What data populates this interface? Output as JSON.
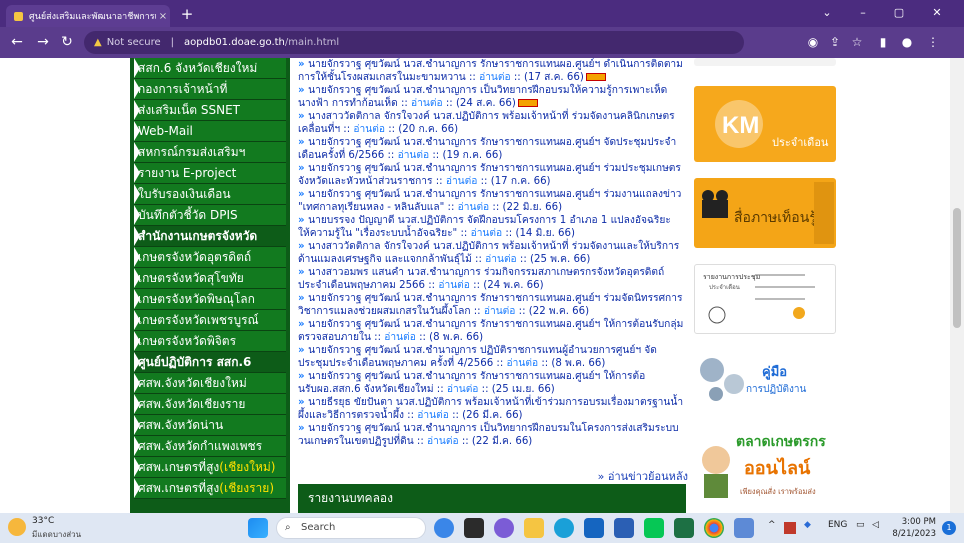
{
  "browser": {
    "tab_title": "ศูนย์ส่งเสริมและพัฒนาอาชีพการเกษตร",
    "tab_close": "×",
    "new_tab": "+",
    "not_secure": "Not secure",
    "separator": "|",
    "url_domain": "aopdb01.doae.go.th",
    "url_path": "/main.html",
    "win_controls": [
      "⌄",
      "–",
      "▢",
      "✕"
    ]
  },
  "sidebar": {
    "items": [
      {
        "label": "สสก.6 จังหวัดเชียงใหม่"
      },
      {
        "label": "กองการเจ้าหน้าที่"
      },
      {
        "label": "ส่งเสริมเน็ต SSNET"
      },
      {
        "label": "Web-Mail"
      },
      {
        "label": "สหกรณ์กรมส่งเสริมฯ"
      },
      {
        "label": "รายงาน E-project"
      },
      {
        "label": "ใบรับรองเงินเดือน"
      },
      {
        "label": "บันทึกตัวชี้วัด DPIS"
      },
      {
        "label": "สำนักงานเกษตรจังหวัด",
        "header": true
      },
      {
        "label": "เกษตรจังหวัดอุตรดิตถ์"
      },
      {
        "label": "เกษตรจังหวัดสุโขทัย"
      },
      {
        "label": "เกษตรจังหวัดพิษณุโลก"
      },
      {
        "label": "เกษตรจังหวัดเพชรบูรณ์"
      },
      {
        "label": "เกษตรจังหวัดพิจิตร"
      },
      {
        "label": "ศูนย์ปฏิบัติการ สสก.6",
        "header": true
      },
      {
        "label": "ศสพ.จังหวัดเชียงใหม่"
      },
      {
        "label": "ศสพ.จังหวัดเชียงราย"
      },
      {
        "label": "ศสพ.จังหวัดน่าน"
      },
      {
        "label": "ศสพ.จังหวัดกำแพงเพชร"
      },
      {
        "label": "ศสพ.เกษตรที่สูง",
        "suffix": "(เชียงใหม่)"
      },
      {
        "label": "ศสพ.เกษตรที่สูง",
        "suffix": "(เชียงราย)"
      }
    ]
  },
  "news": {
    "read_more": "อ่านต่อ",
    "items": [
      {
        "text": "นายจักรวาฐ ศุขวัฒน์ นวส.ชำนาญการ รักษาราชการแทนผอ.ศูนย์ฯ ดำเนินการติดตามการให้ชั้นโรงผสมเกสรในมะขามหวาน",
        "date": "(17 ส.ค. 66)",
        "new": true
      },
      {
        "text": "นายจักรวาฐ ศุขวัฒน์ นวส.ชำนาญการ เป็นวิทยากรฝึกอบรมให้ความรู้การเพาะเห็ดนางฟ้า การทำก้อนเห็ด",
        "date": "(24 ส.ค. 66)",
        "new": true
      },
      {
        "text": "นางสาววัดติกาล จักรใจวงค์ นวส.ปฏิบัติการ พร้อมเจ้าหน้าที่ ร่วมจัดงานคลินิกเกษตรเคลื่อนที่ฯ",
        "date": "(20 ก.ค. 66)",
        "new": false
      },
      {
        "text": "นายจักรวาฐ ศุขวัฒน์ นวส.ชำนาญการ รักษาราชการแทนผอ.ศูนย์ฯ จัดประชุมประจำเดือนครั้งที่ 6/2566",
        "date": "(19 ก.ค. 66)",
        "new": false
      },
      {
        "text": "นายจักรวาฐ ศุขวัฒน์ นวส.ชำนาญการ รักษาราชการแทนผอ.ศูนย์ฯ ร่วมประชุมเกษตรจังหวัดและหัวหน้าส่วนราชการ",
        "date": "(17 ก.ค. 66)",
        "new": false
      },
      {
        "text": "นายจักรวาฐ ศุขวัฒน์ นวส.ชำนาญการ รักษาราชการแทนผอ.ศูนย์ฯ ร่วมงานแถลงข่าว \"เทศกาลทุเรียนหลง - หลินลับแล\"",
        "date": "(22 มิ.ย. 66)",
        "new": false
      },
      {
        "text": "นายบรรจง ปัญญาดี นวส.ปฏิบัติการ จัดฝึกอบรมโครงการ 1 อำเภอ 1 แปลงอัจฉริยะ ให้ความรู้ใน \"เรื่องระบบน้ำอัจฉริยะ\"",
        "date": "(14 มิ.ย. 66)",
        "new": false
      },
      {
        "text": "นางสาววัดติกาล จักรใจวงค์ นวส.ปฏิบัติการ พร้อมเจ้าหน้าที่ ร่วมจัดงานและให้บริการด้านแมลงเศรษฐกิจ และแจกกล้าพันธุ์ไม้",
        "date": "(25 พ.ค. 66)",
        "new": false
      },
      {
        "text": "นางสาวอมพร แสนคำ นวส.ชำนาญการ ร่วมกิจกรรมสภาเกษตรกรจังหวัดอุตรดิตถ์ประจำเดือนพฤษภาคม 2566",
        "date": "(24 พ.ค. 66)",
        "new": false
      },
      {
        "text": "นายจักรวาฐ ศุขวัฒน์ นวส.ชำนาญการ รักษาราชการแทนผอ.ศูนย์ฯ ร่วมจัดนิทรรศการวิชาการแมลงช่วยผสมเกสรในวันผึ้งโลก",
        "date": "(22 พ.ค. 66)",
        "new": false
      },
      {
        "text": "นายจักรวาฐ ศุขวัฒน์ นวส.ชำนาญการ รักษาราชการแทนผอ.ศูนย์ฯ ให้การต้อนรับกลุ่มตรวจสอบภายใน",
        "date": "(8 พ.ค. 66)",
        "new": false
      },
      {
        "text": "นายจักรวาฐ ศุขวัฒน์ นวส.ชำนาญการ ปฏิบัติราชการแทนผู้อำนวยการศูนย์ฯ จัดประชุมประจำเดือนพฤษภาคม ครั้งที่ 4/2566",
        "date": "(8 พ.ค. 66)",
        "new": false
      },
      {
        "text": "นายจักรวาฐ ศุขวัฒน์ นวส.ชำนาญการ รักษาราชการแทนผอ.ศูนย์ฯ ให้การต้อนรับผอ.สสก.6 จังหวัดเชียงใหม่",
        "date": "(25 เม.ย. 66)",
        "new": false
      },
      {
        "text": "นายธีรยุธ ขัยปันตา นวส.ปฏิบัติการ พร้อมเจ้าหน้าที่เข้าร่วมการอบรมเรื่องมาตรฐานน้ำผึ้งและวิธีการตรวจน้ำผึ้ง",
        "date": "(26 มี.ค. 66)",
        "new": false
      },
      {
        "text": "นายจักรวาฐ ศุขวัฒน์ นวส.ชำนาญการ เป็นวิทยากรฝึกอบรมในโครงการส่งเสริมระบบวนเกษตรในเขตปฏิรูปที่ดิน",
        "date": "(22 มี.ค. 66)",
        "new": false
      }
    ],
    "more_label": "» อ่านข่าวย้อนหลัง",
    "section_bar": "รายงานบทคลอง"
  },
  "right_col": {
    "km_text": "KM",
    "km_sub": "ประจำเดือน",
    "media_text": "สื่อภาษเท็อนรู้",
    "report_title": "รายงานการประชุม",
    "report_sub": "ประจำเดือน",
    "manual_title": "คู่มือ",
    "manual_sub": "การปฏิบัติงาน",
    "market_title": "ตลาดเกษตรกร",
    "market_sub": "ออนไลน์",
    "market_tag": "เพียงคุณสั่ง เราพร้อมส่ง"
  },
  "taskbar": {
    "temp": "33°C",
    "weather_desc": "มีแดดบางส่วน",
    "search_placeholder": "Search",
    "lang": "ENG",
    "time": "3:00 PM",
    "date": "8/21/2023",
    "notif": "1"
  },
  "colors": {
    "sidebar_green": "#127a1f",
    "browser_purple": "#4b2c7f",
    "link_blue": "#0d2ca8"
  }
}
